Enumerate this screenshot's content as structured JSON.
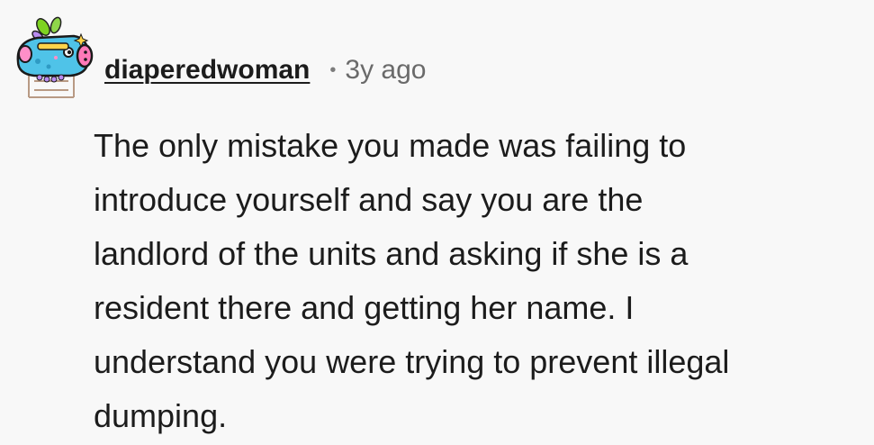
{
  "comment": {
    "author": "diaperedwoman",
    "separator": "•",
    "timestamp": "3y ago",
    "body_lines": [
      "The only mistake you made was failing to",
      "introduce yourself and say you are the",
      "landlord of the units and asking if she is a",
      "resident there and getting her name. I",
      "understand you were trying to prevent illegal",
      "dumping."
    ]
  },
  "colors": {
    "background": "#f8f8f8",
    "text": "#1c1c1c",
    "muted": "#6a6a6a"
  }
}
